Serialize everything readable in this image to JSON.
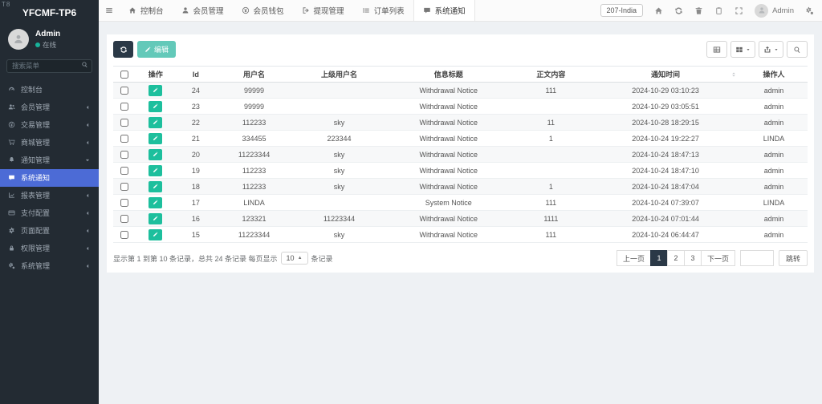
{
  "corner_tag": "T8",
  "colors": {
    "accent": "#4c6bd6",
    "sidebar_bg": "#232b33",
    "sidebar_text": "#a0aab4",
    "dark_btn": "#2b3947",
    "green": "#1dbf9d",
    "edit_btn": "#63c9b9",
    "online": "#18b29a"
  },
  "sidebar": {
    "logo": "YFCMF-TP6",
    "user": {
      "name": "Admin",
      "status": "在线"
    },
    "search_placeholder": "搜索菜单",
    "items": [
      {
        "label": "控制台",
        "icon": "gauge",
        "arrow": "none"
      },
      {
        "label": "会员管理",
        "icon": "users",
        "arrow": "left"
      },
      {
        "label": "交易管理",
        "icon": "coin",
        "arrow": "left"
      },
      {
        "label": "商城管理",
        "icon": "cart",
        "arrow": "left"
      },
      {
        "label": "通知管理",
        "icon": "bell",
        "arrow": "down"
      },
      {
        "label": "系统通知",
        "icon": "comment",
        "arrow": "none",
        "active": true
      },
      {
        "label": "报表管理",
        "icon": "chart",
        "arrow": "left"
      },
      {
        "label": "支付配置",
        "icon": "card",
        "arrow": "left"
      },
      {
        "label": "页面配置",
        "icon": "gear",
        "arrow": "left"
      },
      {
        "label": "权限管理",
        "icon": "lock",
        "arrow": "left"
      },
      {
        "label": "系统管理",
        "icon": "cogs",
        "arrow": "left"
      }
    ]
  },
  "topbar": {
    "tabs": [
      {
        "label": "控制台",
        "icon": "home"
      },
      {
        "label": "会员管理",
        "icon": "user"
      },
      {
        "label": "会员钱包",
        "icon": "coin"
      },
      {
        "label": "提现管理",
        "icon": "signout"
      },
      {
        "label": "订单列表",
        "icon": "list"
      },
      {
        "label": "系统通知",
        "icon": "comment",
        "active": true
      }
    ],
    "region_badge": "207-India",
    "user_label": "Admin"
  },
  "toolbar": {
    "edit_label": "编辑"
  },
  "table": {
    "columns": [
      "操作",
      "Id",
      "用户名",
      "上级用户名",
      "信息标题",
      "正文内容",
      "通知时间",
      "操作人"
    ],
    "sorted_column": "通知时间",
    "rows": [
      {
        "id": "24",
        "username": "99999",
        "parent": "",
        "title": "Withdrawal Notice",
        "content": "111",
        "time": "2024-10-29 03:10:23",
        "operator": "admin"
      },
      {
        "id": "23",
        "username": "99999",
        "parent": "",
        "title": "Withdrawal Notice",
        "content": "",
        "time": "2024-10-29 03:05:51",
        "operator": "admin"
      },
      {
        "id": "22",
        "username": "112233",
        "parent": "sky",
        "title": "Withdrawal Notice",
        "content": "11",
        "time": "2024-10-28 18:29:15",
        "operator": "admin"
      },
      {
        "id": "21",
        "username": "334455",
        "parent": "223344",
        "title": "Withdrawal Notice",
        "content": "1",
        "time": "2024-10-24 19:22:27",
        "operator": "LINDA"
      },
      {
        "id": "20",
        "username": "11223344",
        "parent": "sky",
        "title": "Withdrawal Notice",
        "content": "",
        "time": "2024-10-24 18:47:13",
        "operator": "admin"
      },
      {
        "id": "19",
        "username": "112233",
        "parent": "sky",
        "title": "Withdrawal Notice",
        "content": "",
        "time": "2024-10-24 18:47:10",
        "operator": "admin"
      },
      {
        "id": "18",
        "username": "112233",
        "parent": "sky",
        "title": "Withdrawal Notice",
        "content": "1",
        "time": "2024-10-24 18:47:04",
        "operator": "admin"
      },
      {
        "id": "17",
        "username": "LINDA",
        "parent": "",
        "title": "System Notice",
        "content": "111",
        "time": "2024-10-24 07:39:07",
        "operator": "LINDA"
      },
      {
        "id": "16",
        "username": "123321",
        "parent": "11223344",
        "title": "Withdrawal Notice",
        "content": "1111",
        "time": "2024-10-24 07:01:44",
        "operator": "admin"
      },
      {
        "id": "15",
        "username": "11223344",
        "parent": "sky",
        "title": "Withdrawal Notice",
        "content": "111",
        "time": "2024-10-24 06:44:47",
        "operator": "admin"
      }
    ]
  },
  "pagination": {
    "summary_prefix": "显示第 1 到第 10 条记录，总共 24 条记录 每页显示",
    "page_size": "10",
    "summary_suffix": "条记录",
    "prev_label": "上一页",
    "pages": [
      "1",
      "2",
      "3"
    ],
    "active_page": "1",
    "next_label": "下一页",
    "jump_label": "跳转"
  }
}
